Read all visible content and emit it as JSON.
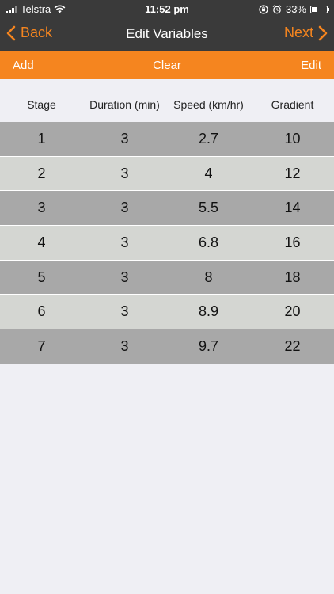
{
  "status_bar": {
    "carrier": "Telstra",
    "time": "11:52 pm",
    "battery": "33%"
  },
  "nav": {
    "back_label": "Back",
    "title": "Edit Variables",
    "next_label": "Next"
  },
  "toolbar": {
    "add_label": "Add",
    "clear_label": "Clear",
    "edit_label": "Edit"
  },
  "table": {
    "headers": [
      "Stage",
      "Duration (min)",
      "Speed (km/hr)",
      "Gradient"
    ],
    "rows": [
      [
        "1",
        "3",
        "2.7",
        "10"
      ],
      [
        "2",
        "3",
        "4",
        "12"
      ],
      [
        "3",
        "3",
        "5.5",
        "14"
      ],
      [
        "4",
        "3",
        "6.8",
        "16"
      ],
      [
        "5",
        "3",
        "8",
        "18"
      ],
      [
        "6",
        "3",
        "8.9",
        "20"
      ],
      [
        "7",
        "3",
        "9.7",
        "22"
      ]
    ]
  },
  "colors": {
    "accent": "#f5851f",
    "nav_background": "#3a3a3a",
    "row_dark": "#a8a8a8",
    "row_light": "#d4d6d2"
  }
}
